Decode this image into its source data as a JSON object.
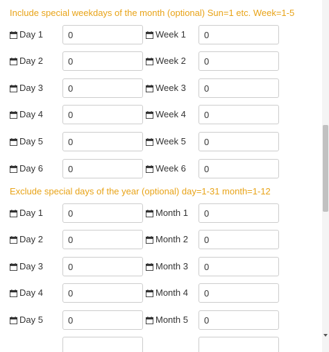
{
  "include_section": {
    "title": "Include special weekdays of the month (optional) Sun=1 etc. Week=1-5",
    "rows": [
      {
        "left_label": "Day 1",
        "left_value": "0",
        "right_label": "Week 1",
        "right_value": "0"
      },
      {
        "left_label": "Day 2",
        "left_value": "0",
        "right_label": "Week 2",
        "right_value": "0"
      },
      {
        "left_label": "Day 3",
        "left_value": "0",
        "right_label": "Week 3",
        "right_value": "0"
      },
      {
        "left_label": "Day 4",
        "left_value": "0",
        "right_label": "Week 4",
        "right_value": "0"
      },
      {
        "left_label": "Day 5",
        "left_value": "0",
        "right_label": "Week 5",
        "right_value": "0"
      },
      {
        "left_label": "Day 6",
        "left_value": "0",
        "right_label": "Week 6",
        "right_value": "0"
      }
    ]
  },
  "exclude_section": {
    "title": "Exclude special days of the year (optional) day=1-31 month=1-12",
    "rows": [
      {
        "left_label": "Day 1",
        "left_value": "0",
        "right_label": "Month 1",
        "right_value": "0"
      },
      {
        "left_label": "Day 2",
        "left_value": "0",
        "right_label": "Month 2",
        "right_value": "0"
      },
      {
        "left_label": "Day 3",
        "left_value": "0",
        "right_label": "Month 3",
        "right_value": "0"
      },
      {
        "left_label": "Day 4",
        "left_value": "0",
        "right_label": "Month 4",
        "right_value": "0"
      },
      {
        "left_label": "Day 5",
        "left_value": "0",
        "right_label": "Month 5",
        "right_value": "0"
      }
    ]
  },
  "icons": {
    "label_icon": "calendar-icon"
  },
  "colors": {
    "section_title": "#e8a317",
    "text": "#333333",
    "field_border": "#cccccc"
  }
}
